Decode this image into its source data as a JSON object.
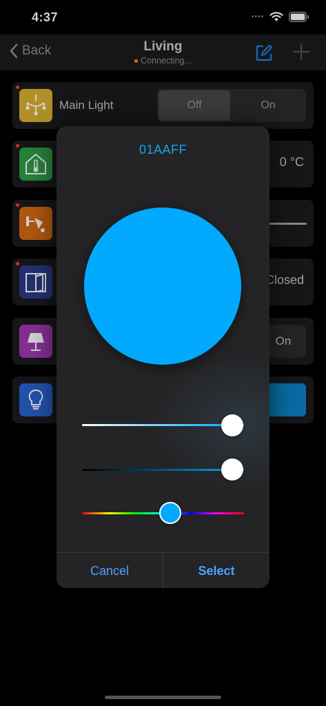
{
  "status_bar": {
    "time": "4:37",
    "icons": [
      "signal-icon",
      "wifi-icon",
      "battery-icon"
    ]
  },
  "nav": {
    "back_label": "Back",
    "title": "Living",
    "subtitle": "Connecting...",
    "status_color": "#ff9500",
    "edit_icon": "edit-icon",
    "add_icon": "plus-icon"
  },
  "rows": [
    {
      "label": "Main Light",
      "icon": "chandelier-icon",
      "icon_color": "#d8b030",
      "segments": [
        "Off",
        "On"
      ],
      "selected": "Off"
    },
    {
      "value": "0 °C",
      "icon": "home-thermometer-icon",
      "icon_color": "#2f9e46",
      "alert": true
    },
    {
      "icon": "wall-lamp-icon",
      "icon_color": "#d46a12",
      "alert": true
    },
    {
      "value": "Closed",
      "icon": "door-icon",
      "icon_color": "#2c3a8c",
      "alert": true
    },
    {
      "value": "On",
      "icon": "table-lamp-icon",
      "icon_color": "#a03ab0"
    },
    {
      "icon": "bulb-icon",
      "icon_color": "#2a63d0",
      "accent": "#0a84c6"
    }
  ],
  "color_dialog": {
    "hex": "01AAFF",
    "color": "#01AAFF",
    "saturation": 1.0,
    "brightness": 1.0,
    "hue_deg": 200,
    "cancel_label": "Cancel",
    "select_label": "Select"
  }
}
